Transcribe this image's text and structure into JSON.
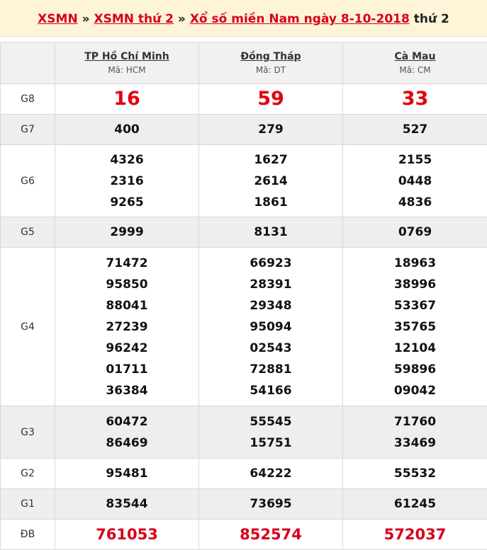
{
  "header": {
    "link1": "XSMN",
    "sep1": " » ",
    "link2": "XSMN thứ 2",
    "sep2": " » ",
    "link3": "Xổ số miền Nam ngày 8-10-2018",
    "suffix": " thứ 2"
  },
  "provinces": [
    {
      "name": "TP Hồ Chí Minh",
      "code": "Mã: HCM"
    },
    {
      "name": "Đồng Tháp",
      "code": "Mã: DT"
    },
    {
      "name": "Cà Mau",
      "code": "Mã: CM"
    }
  ],
  "prizes": {
    "g8": {
      "label": "G8",
      "values": [
        [
          "16"
        ],
        [
          "59"
        ],
        [
          "33"
        ]
      ]
    },
    "g7": {
      "label": "G7",
      "values": [
        [
          "400"
        ],
        [
          "279"
        ],
        [
          "527"
        ]
      ]
    },
    "g6": {
      "label": "G6",
      "values": [
        [
          "4326",
          "2316",
          "9265"
        ],
        [
          "1627",
          "2614",
          "1861"
        ],
        [
          "2155",
          "0448",
          "4836"
        ]
      ]
    },
    "g5": {
      "label": "G5",
      "values": [
        [
          "2999"
        ],
        [
          "8131"
        ],
        [
          "0769"
        ]
      ]
    },
    "g4": {
      "label": "G4",
      "values": [
        [
          "71472",
          "95850",
          "88041",
          "27239",
          "96242",
          "01711",
          "36384"
        ],
        [
          "66923",
          "28391",
          "29348",
          "95094",
          "02543",
          "72881",
          "54166"
        ],
        [
          "18963",
          "38996",
          "53367",
          "35765",
          "12104",
          "59896",
          "09042"
        ]
      ]
    },
    "g3": {
      "label": "G3",
      "values": [
        [
          "60472",
          "86469"
        ],
        [
          "55545",
          "15751"
        ],
        [
          "71760",
          "33469"
        ]
      ]
    },
    "g2": {
      "label": "G2",
      "values": [
        [
          "95481"
        ],
        [
          "64222"
        ],
        [
          "55532"
        ]
      ]
    },
    "g1": {
      "label": "G1",
      "values": [
        [
          "83544"
        ],
        [
          "73695"
        ],
        [
          "61245"
        ]
      ]
    },
    "db": {
      "label": "ĐB",
      "values": [
        [
          "761053"
        ],
        [
          "852574"
        ],
        [
          "572037"
        ]
      ]
    }
  }
}
